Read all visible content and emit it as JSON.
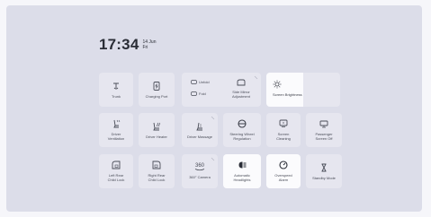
{
  "clock": {
    "time": "17:34",
    "date": "14 Jun",
    "day": "Fri"
  },
  "tiles": {
    "trunk": "Trunk",
    "charging_port": "Charging Port",
    "unfold": "Unfold",
    "fold": "Fold",
    "side_mirror": "Side Mirror\nAdjustment",
    "screen_brightness": "Screen Brightness",
    "driver_ventilation": "Driver\nVentilation",
    "driver_heater": "Driver Heater",
    "driver_massage": "Driver Massage",
    "steering_wheel": "Steering Wheel\nRegulation",
    "screen_cleaning": "Screen\nCleaning",
    "passenger_screen_off": "Passenger\nScreen Off",
    "left_rear_child_lock": "Left Rear\nChild Lock",
    "right_rear_child_lock": "Right Rear\nChild Lock",
    "camera_360": "360° Camera",
    "camera_360_icon": "360",
    "automatic_headlights": "Automatic\nHeadlights",
    "overspeed_alarm": "Overspeed\nAlarm",
    "standby_mode": "Standby Mode"
  },
  "brightness_level": 0.5,
  "icons": {
    "trunk": "trunk-icon",
    "charging_port": "charging-port-icon",
    "unfold": "mirror-unfold-icon",
    "fold": "mirror-fold-icon",
    "side_mirror": "side-mirror-icon",
    "screen_brightness": "sun-icon",
    "driver_ventilation": "seat-ventilation-icon",
    "driver_heater": "seat-heater-icon",
    "driver_massage": "seat-massage-icon",
    "steering_wheel": "steering-wheel-icon",
    "screen_cleaning": "screen-cleaning-icon",
    "passenger_screen_off": "passenger-screen-icon",
    "left_rear_child_lock": "child-lock-icon",
    "right_rear_child_lock": "child-lock-icon",
    "camera_360": "camera-360-icon",
    "automatic_headlights": "headlight-icon",
    "overspeed_alarm": "speed-alarm-icon",
    "standby_mode": "hourglass-icon"
  }
}
